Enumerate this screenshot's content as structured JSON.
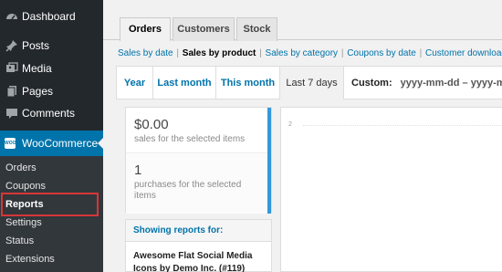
{
  "sidebar": {
    "items": [
      {
        "label": "Dashboard",
        "icon": "dashboard-icon"
      },
      {
        "label": "Posts",
        "icon": "pin-icon"
      },
      {
        "label": "Media",
        "icon": "media-icon"
      },
      {
        "label": "Pages",
        "icon": "pages-icon"
      },
      {
        "label": "Comments",
        "icon": "comment-icon"
      }
    ],
    "woocommerce": {
      "label": "WooCommerce",
      "icon_text": "WOO"
    },
    "submenu": [
      "Orders",
      "Coupons",
      "Reports",
      "Settings",
      "Status",
      "Extensions"
    ]
  },
  "tabs": [
    "Orders",
    "Customers",
    "Stock"
  ],
  "subsub": {
    "links": [
      "Sales by date",
      "Sales by product",
      "Sales by category",
      "Coupons by date",
      "Customer downloads"
    ],
    "separator": "|"
  },
  "ranges": [
    "Year",
    "Last month",
    "This month",
    "Last 7 days"
  ],
  "custom": {
    "label": "Custom:",
    "placeholder": "yyyy-mm-dd – yyyy-mm-"
  },
  "stats": [
    {
      "value": "$0.00",
      "desc": "sales for the selected items"
    },
    {
      "value": "1",
      "desc": "purchases for the selected items"
    }
  ],
  "showing": {
    "heading": "Showing reports for:",
    "product": "Awesome Flat Social Media Icons by Demo Inc. (#119)"
  },
  "chart": {
    "tick": "2"
  },
  "colors": {
    "sidebar": "#23282d",
    "accent": "#0073aa",
    "highlight": "#d63638",
    "stat_strip": "#3498db"
  }
}
